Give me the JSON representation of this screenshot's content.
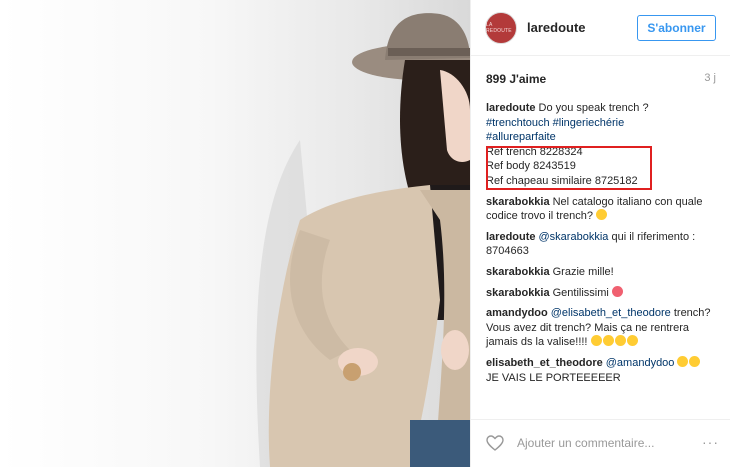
{
  "header": {
    "avatar_text": "LA REDOUTE",
    "username": "laredoute",
    "follow_label": "S'abonner"
  },
  "stats": {
    "likes": "899 J'aime",
    "time": "3 j"
  },
  "caption": {
    "user": "laredoute",
    "text": "Do you speak trench ?",
    "tags": [
      "#trenchtouch",
      "#lingeriechérie",
      "#allureparfaite"
    ],
    "refs": [
      "Ref trench 8228324",
      "Ref body 8243519",
      "Ref chapeau similaire 8725182"
    ]
  },
  "comments": [
    {
      "user": "skarabokkia",
      "text": "Nel catalogo italiano con quale codice trovo il trench?"
    },
    {
      "user": "laredoute",
      "mention": "@skarabokkia",
      "text": "qui il riferimento : 8704663"
    },
    {
      "user": "skarabokkia",
      "text": "Grazie mille!"
    },
    {
      "user": "skarabokkia",
      "text": "Gentilissimi"
    },
    {
      "user": "amandydoo",
      "mention": "@elisabeth_et_theodore",
      "text": "trench? Vous avez dit trench? Mais ça ne rentrera jamais ds la valise!!!!"
    },
    {
      "user": "elisabeth_et_theodore",
      "mention": "@amandydoo",
      "text": "JE VAIS LE PORTEEEEER"
    }
  ],
  "footer": {
    "placeholder": "Ajouter un commentaire...",
    "more_label": "···"
  },
  "colors": {
    "link": "#003569",
    "follow": "#3897f0",
    "highlight": "#e02020"
  }
}
